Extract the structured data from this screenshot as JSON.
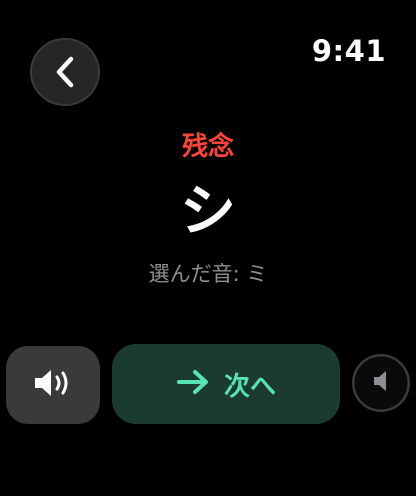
{
  "status_bar": {
    "time": "9:41"
  },
  "navigation": {
    "back_icon": "chevron-left-icon"
  },
  "quiz": {
    "result_label": "残念",
    "kana": "シ",
    "selected_sound_text": "選んだ音: ミ"
  },
  "actions": {
    "sound_icon": "speaker-wave-icon",
    "next_icon": "arrow-right-icon",
    "next_label": "次へ",
    "mini_sound_icon": "speaker-icon"
  },
  "colors": {
    "result_wrong": "#ff453a",
    "next_accent": "#57e3b5",
    "next_background": "#1b3b30",
    "button_gray": "#3a3a3c"
  }
}
